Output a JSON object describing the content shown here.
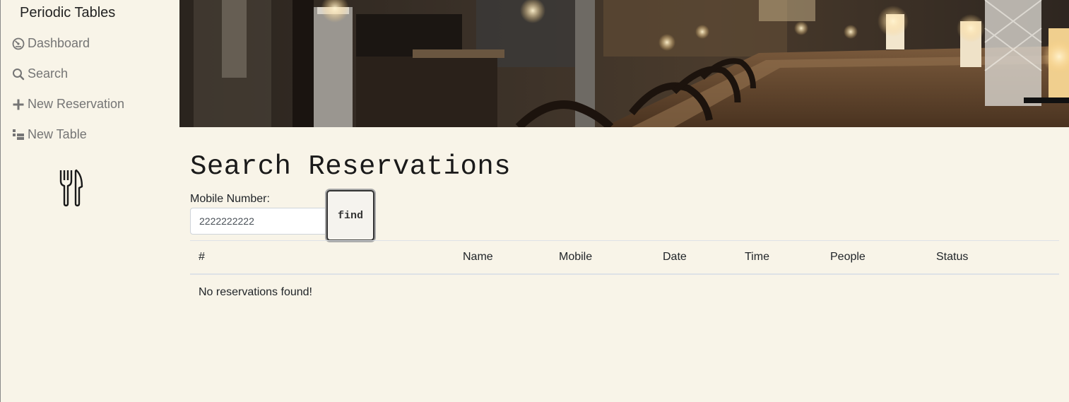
{
  "sidebar": {
    "brand": "Periodic Tables",
    "items": [
      {
        "label": "Dashboard",
        "icon": "dashboard-icon"
      },
      {
        "label": "Search",
        "icon": "search-icon"
      },
      {
        "label": "New Reservation",
        "icon": "plus-icon"
      },
      {
        "label": "New Table",
        "icon": "table-icon"
      }
    ],
    "logo_icon": "utensils-icon"
  },
  "hero": {
    "image": "restaurant-interior-photo"
  },
  "main": {
    "title": "Search Reservations",
    "search": {
      "label": "Mobile Number:",
      "value": "2222222222",
      "button_label": "find"
    },
    "table": {
      "columns": [
        "#",
        "Name",
        "Mobile",
        "Date",
        "Time",
        "People",
        "Status"
      ],
      "empty_message": "No reservations found!"
    }
  },
  "colors": {
    "background": "#f8f4e8",
    "nav_text": "#757575"
  }
}
